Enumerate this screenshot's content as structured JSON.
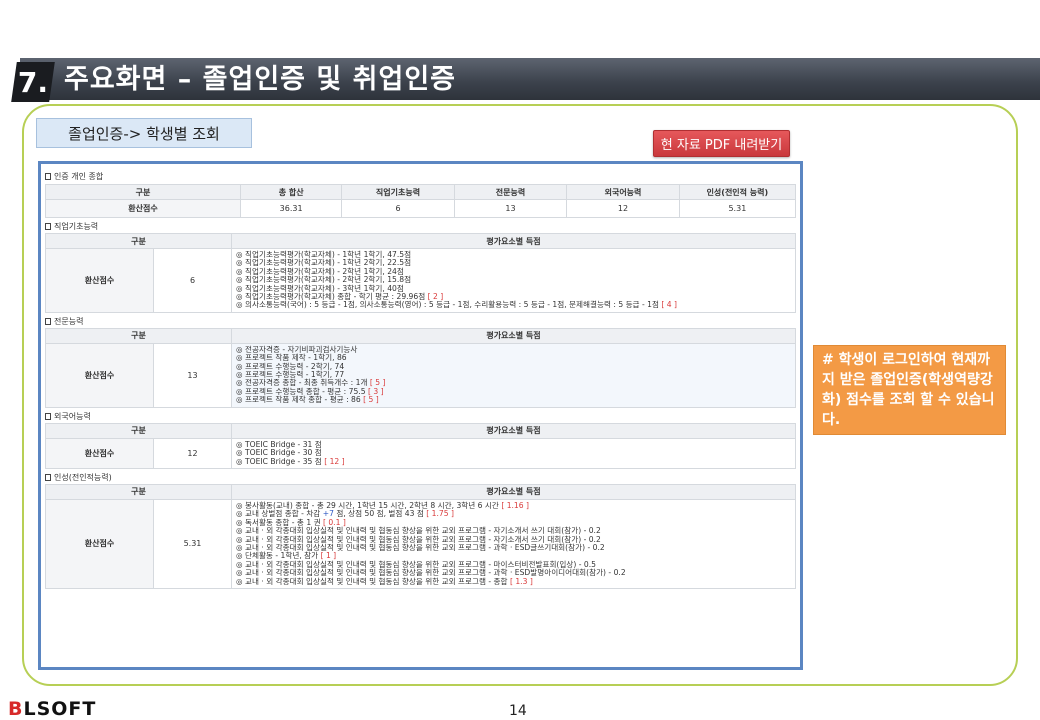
{
  "header": {
    "number": "7.",
    "title": "주요화면 – 졸업인증 및 취업인증"
  },
  "breadcrumb": "졸업인증-> 학생별 조회",
  "pdf_button": "현 자료 PDF 내려받기",
  "summary": {
    "section": "인증 개인 종합",
    "headers": [
      "구분",
      "총 합산",
      "직업기초능력",
      "전문능력",
      "외국어능력",
      "인성(전인적 능력)"
    ],
    "row": [
      "환산점수",
      "36.31",
      "6",
      "13",
      "12",
      "5.31"
    ]
  },
  "sections": [
    {
      "title": "직업기초능력",
      "headers": [
        "구분",
        "평가요소별 득점"
      ],
      "label": "환산점수",
      "score": "6",
      "items": [
        [
          {
            "t": "◎ 직업기초능력평가(학교자체) - 1학년 1학기, 47.5점"
          }
        ],
        [
          {
            "t": "◎ 직업기초능력평가(학교자체) - 1학년 2학기, 22.5점"
          }
        ],
        [
          {
            "t": "◎ 직업기초능력평가(학교자체) - 2학년 1학기, 24점"
          }
        ],
        [
          {
            "t": "◎ 직업기초능력평가(학교자체) - 2학년 2학기, 15.8점"
          }
        ],
        [
          {
            "t": "◎ 직업기초능력평가(학교자체) - 3학년 1학기, 40점"
          }
        ],
        [
          {
            "t": "◎ 직업기초능력평가(학교자체) 종합 - 학기 평균 : 29.96점 "
          },
          {
            "t": "[ 2 ]",
            "c": "red"
          }
        ],
        [
          {
            "t": "◎ 의사소통능력(국어) : 5 등급 - 1점, 의사소통능력(영어) : 5 등급 - 1점, 수리활용능력 : 5 등급 - 1점, 문제해결능력 : 5 등급 - 1점 "
          },
          {
            "t": "[ 4 ]",
            "c": "red"
          }
        ]
      ]
    },
    {
      "title": "전문능력",
      "headers": [
        "구분",
        "평가요소별 득점"
      ],
      "label": "환산점수",
      "score": "13",
      "items": [
        [
          {
            "t": "◎ 전공자격증 - 자기비파괴검사기능사"
          }
        ],
        [
          {
            "t": "◎ 프로젝트 작품 제작 - 1학기, 86"
          }
        ],
        [
          {
            "t": "◎ 프로젝트 수행능력 - 2학기, 74"
          }
        ],
        [
          {
            "t": "◎ 프로젝트 수행능력 - 1학기, 77"
          }
        ],
        [
          {
            "t": "◎ 전공자격증 종합 - 최종 취득개수 : 1개 "
          },
          {
            "t": "[ 5 ]",
            "c": "red"
          }
        ],
        [
          {
            "t": "◎ 프로젝트 수행능력 종합 - 평균 : 75.5 "
          },
          {
            "t": "[ 3 ]",
            "c": "red"
          }
        ],
        [
          {
            "t": "◎ 프로젝트 작품 제작 종합 - 평균 : 86 "
          },
          {
            "t": "[ 5 ]",
            "c": "red"
          }
        ]
      ]
    },
    {
      "title": "외국어능력",
      "headers": [
        "구분",
        "평가요소별 득점"
      ],
      "label": "환산점수",
      "score": "12",
      "items": [
        [
          {
            "t": "◎ TOEIC Bridge - 31 점"
          }
        ],
        [
          {
            "t": "◎ TOEIC Bridge - 30 점"
          }
        ],
        [
          {
            "t": "◎ TOEIC Bridge - 35 점 "
          },
          {
            "t": "[ 12 ]",
            "c": "red"
          }
        ]
      ]
    },
    {
      "title": "인성(전인적능력)",
      "headers": [
        "구분",
        "평가요소별 득점"
      ],
      "label": "환산점수",
      "score": "5.31",
      "items": [
        [
          {
            "t": "◎ 봉사활동(교내) 종합 - 총 29 시간, 1학년 15 시간, 2학년 8 시간, 3학년 6 시간 "
          },
          {
            "t": "[ 1.16 ]",
            "c": "red"
          }
        ],
        [
          {
            "t": "◎ 교내 상벌점 종합 - 차감 "
          },
          {
            "t": "+7",
            "c": "blue"
          },
          {
            "t": " 점, 상점 50 점, 벌점 43 점 "
          },
          {
            "t": "[ 1.75 ]",
            "c": "red"
          }
        ],
        [
          {
            "t": "◎ 독서활동 종합 - 총 1 권 "
          },
          {
            "t": "[ 0.1 ]",
            "c": "red"
          }
        ],
        [
          {
            "t": "◎ 교내 · 외 각종대회 입상실적 및 인내력 및 협동심 향상을 위한 교외 프로그램 - 자기소개서 쓰기 대회(참가) - 0.2"
          }
        ],
        [
          {
            "t": "◎ 교내 · 외 각종대회 입상실적 및 인내력 및 협동심 향상을 위한 교외 프로그램 - 자기소개서 쓰기 대회(참가) - 0.2"
          }
        ],
        [
          {
            "t": "◎ 교내 · 외 각종대회 입상실적 및 인내력 및 협동심 향상을 위한 교외 프로그램 - 과학 · ESD글쓰기대회(참가) - 0.2"
          }
        ],
        [
          {
            "t": "◎ 단체활동 - 1학년, 참가 "
          },
          {
            "t": "[ 1 ]",
            "c": "red"
          }
        ],
        [
          {
            "t": "◎ 교내 · 외 각종대회 입상실적 및 인내력 및 협동심 향상을 위한 교외 프로그램 - 마이스터비전발표회(입상) - 0.5"
          }
        ],
        [
          {
            "t": "◎ 교내 · 외 각종대회 입상실적 및 인내력 및 협동심 향상을 위한 교외 프로그램 - 과학 · ESD발명아이디어대회(참가) - 0.2"
          }
        ],
        [
          {
            "t": "◎ 교내 · 외 각종대회 입상실적 및 인내력 및 협동심 향상을 위한 교외 프로그램 - 종합 "
          },
          {
            "t": "[ 1.3 ]",
            "c": "red"
          }
        ]
      ]
    }
  ],
  "callout": "# 학생이 로그인하여 현재까지 받은 졸업인증(학생역량강화) 점수를 조회 할 수 있습니다.",
  "footer": {
    "logo_prefix": "B",
    "logo_rest": "LSOFT",
    "page": "14"
  }
}
